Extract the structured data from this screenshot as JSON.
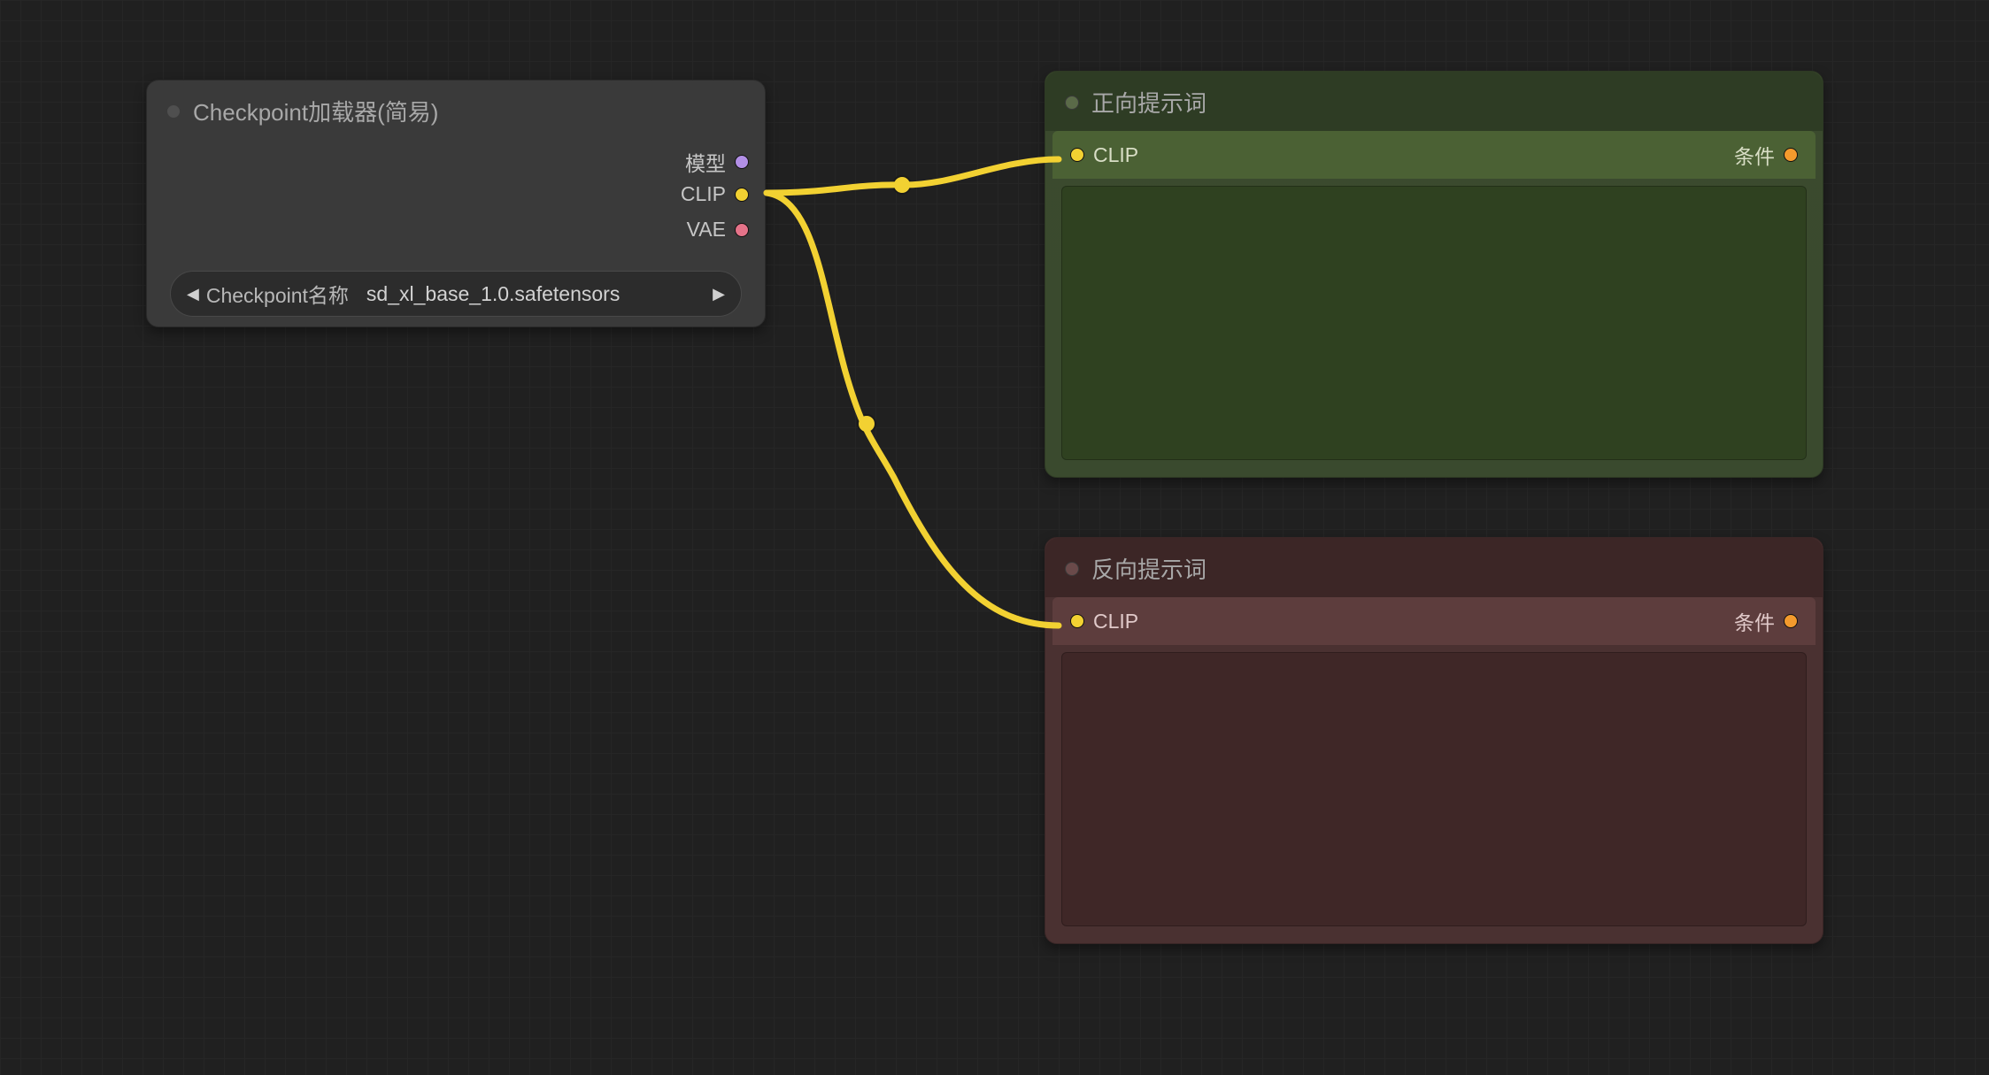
{
  "colors": {
    "port_model": "#b28fe6",
    "port_clip": "#f2d132",
    "port_vae": "#e57389",
    "port_conditioning": "#f39a2d",
    "wire": "#f2d132"
  },
  "nodes": {
    "checkpoint_loader": {
      "title": "Checkpoint加载器(简易)",
      "outputs": {
        "model": "模型",
        "clip": "CLIP",
        "vae": "VAE"
      },
      "widget": {
        "label": "Checkpoint名称",
        "value": "sd_xl_base_1.0.safetensors"
      }
    },
    "positive_prompt": {
      "title": "正向提示词",
      "input_clip": "CLIP",
      "output_conditioning": "条件",
      "text": ""
    },
    "negative_prompt": {
      "title": "反向提示词",
      "input_clip": "CLIP",
      "output_conditioning": "条件",
      "text": ""
    }
  },
  "connections": [
    {
      "from": "checkpoint_loader.clip",
      "to": "positive_prompt.clip"
    },
    {
      "from": "checkpoint_loader.clip",
      "to": "negative_prompt.clip"
    }
  ]
}
